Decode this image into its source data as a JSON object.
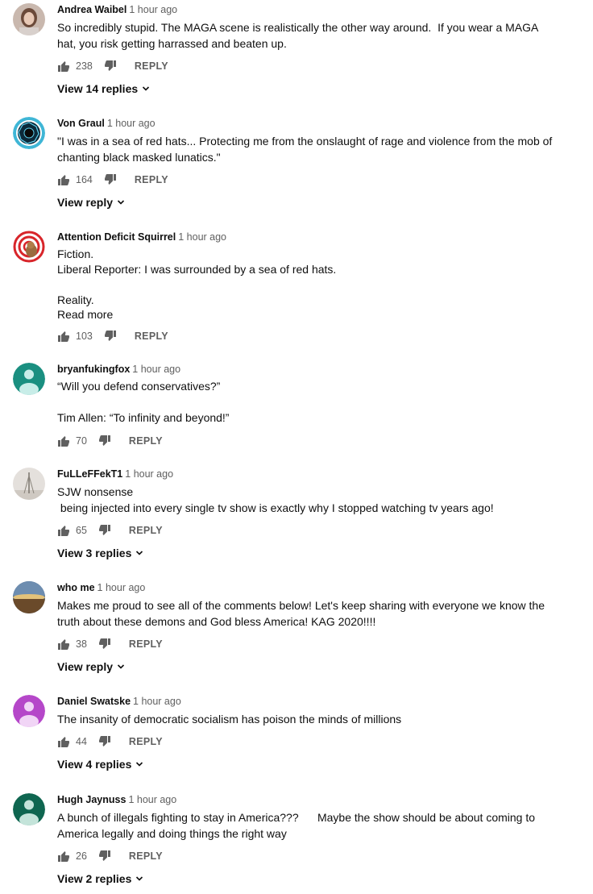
{
  "comments": [
    {
      "author": "Andrea Waibel",
      "time": "1 hour ago",
      "text": "So incredibly stupid. The MAGA scene is realistically the other way around.  If you wear a MAGA hat, you risk getting harrassed and beaten up.",
      "likes": "238",
      "reply_label": "REPLY",
      "view_replies": "View 14 replies",
      "avatar": "photo-woman"
    },
    {
      "author": "Von Graul",
      "time": "1 hour ago",
      "text": "\"I was in a sea of red hats... Protecting me from the onslaught of rage and violence from the mob of chanting black masked lunatics.\"",
      "likes": "164",
      "reply_label": "REPLY",
      "view_replies": "View reply",
      "avatar": "geometric-emblem"
    },
    {
      "author": "Attention Deficit Squirrel",
      "time": "1 hour ago",
      "text": "Fiction.\nLiberal Reporter: I was surrounded by a sea of red hats.\n\nReality.",
      "read_more": "Read more",
      "likes": "103",
      "reply_label": "REPLY",
      "avatar": "squirrel-target"
    },
    {
      "author": "bryanfukingfox",
      "time": "1 hour ago",
      "text": "“Will you defend conservatives?”\n\nTim Allen: “To infinity and beyond!”",
      "likes": "70",
      "reply_label": "REPLY",
      "avatar": "default-teal"
    },
    {
      "author": "FuLLeFFekT1",
      "time": "1 hour ago",
      "text": "SJW nonsense\n being injected into every single tv show is exactly why I stopped watching tv years ago!",
      "likes": "65",
      "reply_label": "REPLY",
      "view_replies": "View 3 replies",
      "avatar": "photo-tower"
    },
    {
      "author": "who me",
      "time": "1 hour ago",
      "text": "Makes me proud to see all of the comments below! Let's keep sharing with everyone we know the truth about these demons and God bless America! KAG 2020!!!!",
      "likes": "38",
      "reply_label": "REPLY",
      "view_replies": "View reply",
      "avatar": "photo-landscape"
    },
    {
      "author": "Daniel Swatske",
      "time": "1 hour ago",
      "text": "The insanity of democratic socialism has poison the minds of millions",
      "likes": "44",
      "reply_label": "REPLY",
      "view_replies": "View 4 replies",
      "avatar": "default-purple"
    },
    {
      "author": "Hugh Jaynuss",
      "time": "1 hour ago",
      "text": "A bunch of illegals fighting to stay in America???      Maybe the show should be about coming to America legally and doing things the right way",
      "likes": "26",
      "reply_label": "REPLY",
      "view_replies": "View 2 replies",
      "avatar": "default-green"
    }
  ],
  "colors": {
    "default-teal": "#1a8f80",
    "default-purple": "#b547c9",
    "default-green": "#0f6650",
    "meta": "#606060"
  }
}
